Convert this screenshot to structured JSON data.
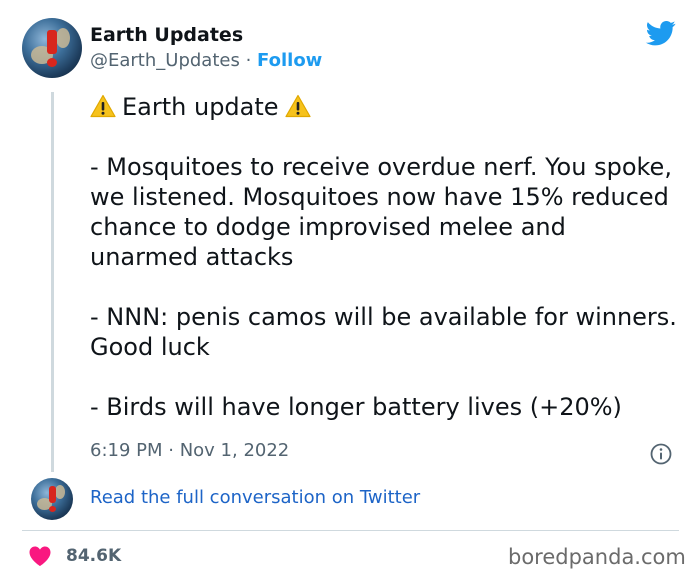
{
  "account": {
    "name": "Earth Updates",
    "handle": "@Earth_Updates",
    "separator": "·",
    "follow_label": "Follow"
  },
  "tweet": {
    "headline": "Earth update",
    "paragraph_1": "- Mosquitoes to receive overdue nerf. You spoke, we listened. Mosquitoes now have 15% reduced chance to dodge improvised melee and unarmed attacks",
    "paragraph_2": "- NNN: penis camos will be available for winners. Good luck",
    "paragraph_3": "- Birds will have longer battery lives  (+20%)",
    "timestamp": "6:19 PM · Nov 1, 2022"
  },
  "footer": {
    "read_link": "Read the full conversation on Twitter",
    "likes": "84.6K",
    "watermark": "boredpanda.com"
  },
  "icons": {
    "brand": "twitter-bird-icon",
    "warning": "warning-icon",
    "info": "info-icon",
    "like": "heart-icon"
  },
  "colors": {
    "accent": "#1d9bf0",
    "link": "#1d64c7",
    "heart": "#f91880",
    "muted": "#536471"
  }
}
